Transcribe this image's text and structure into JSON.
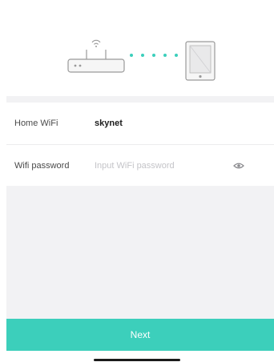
{
  "illustration": {
    "router_icon": "router-icon",
    "wifi_signal_icon": "wifi-signal-icon",
    "connection_dots_icon": "connection-dots-icon",
    "tablet_icon": "tablet-icon",
    "accent_color": "#3ccfbb"
  },
  "form": {
    "wifi_row": {
      "label": "Home WiFi",
      "value": "skynet"
    },
    "password_row": {
      "label": "Wifi password",
      "value": "",
      "placeholder": "Input WiFi password",
      "toggle_icon": "eye-icon"
    }
  },
  "actions": {
    "next_label": "Next",
    "next_color": "#3ccfbb"
  }
}
